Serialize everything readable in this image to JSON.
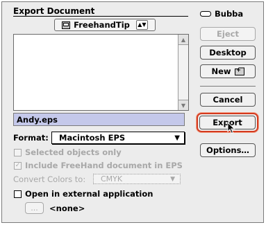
{
  "dialog": {
    "title": "Export Document",
    "folder_popup": {
      "label": "FreehandTip",
      "arrows": "▲▼"
    },
    "disk": {
      "label": "Bubba"
    },
    "buttons": {
      "eject": "Eject",
      "desktop": "Desktop",
      "new_folder": "New",
      "cancel": "Cancel",
      "export": "Export",
      "options": "Options…"
    },
    "file_name": {
      "value": "Andy.eps"
    },
    "format": {
      "label": "Format:",
      "value": "Macintosh EPS"
    },
    "options": {
      "selected_objects_only": {
        "label": "Selected objects only",
        "checked": false,
        "enabled": false
      },
      "include_freehand": {
        "label": "Include FreeHand document in EPS",
        "checked": true,
        "enabled": false
      },
      "convert_colors": {
        "label": "Convert Colors to:",
        "value": "CMYK",
        "enabled": false
      },
      "open_external": {
        "label": "Open in external application",
        "checked": false,
        "enabled": true
      },
      "app_button": {
        "label": "...",
        "app_name": "<none>"
      }
    },
    "colors": {
      "highlight": "#c4c8ea",
      "default_ring": "#d43a1e",
      "disabled": "#a8a8a8"
    }
  }
}
